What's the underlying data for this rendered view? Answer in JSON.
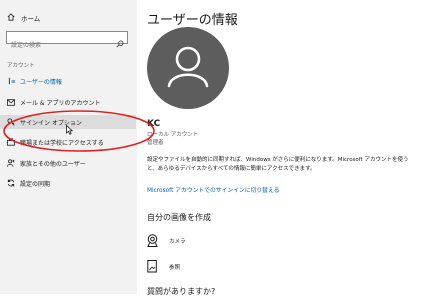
{
  "sidebar": {
    "home_label": "ホーム",
    "search_placeholder": "設定の検索",
    "section_label": "アカウント",
    "items": [
      {
        "label": "ユーザーの情報",
        "icon": "person-icon"
      },
      {
        "label": "メール & アプリのアカウント",
        "icon": "mail-icon"
      },
      {
        "label": "サインイン オプション",
        "icon": "key-icon"
      },
      {
        "label": "職場または学校にアクセスする",
        "icon": "briefcase-icon"
      },
      {
        "label": "家族とその他のユーザー",
        "icon": "add-person-icon"
      },
      {
        "label": "設定の同期",
        "icon": "sync-icon"
      }
    ]
  },
  "main": {
    "title": "ユーザーの情報",
    "user_name": "KC",
    "account_type": "ローカル アカウント",
    "role": "管理者",
    "description": "設定やファイルを自動的に同期すれば、Windows がさらに便利になります。Microsoft アカウントを使うと、あらゆるデバイスからすべての情報に簡単にアクセスできます。",
    "signin_link": "Microsoft アカウントでのサインインに切り替える",
    "create_picture_heading": "自分の画像を作成",
    "options": [
      {
        "label": "カメラ",
        "icon": "camera-icon"
      },
      {
        "label": "参照",
        "icon": "browse-icon"
      }
    ],
    "cut_heading": "質問がありますか?"
  },
  "colors": {
    "accent": "#0063b1",
    "sidebar_bg": "#f2f2f2",
    "annotation": "#e02020",
    "avatar_bg": "#5d5d5d"
  }
}
